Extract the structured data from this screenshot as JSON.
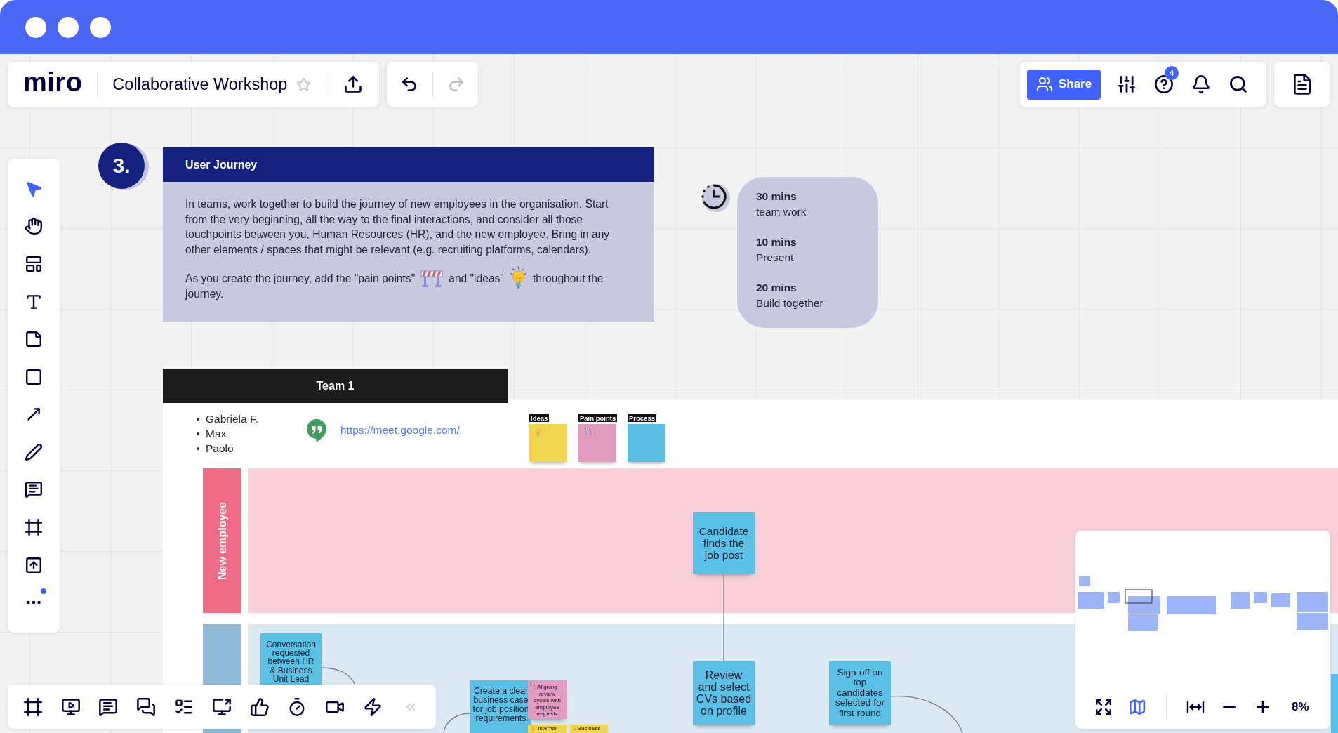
{
  "board_header": {
    "logo": "miro",
    "title": "Collaborative Workshop",
    "starred": false
  },
  "history": [
    {
      "kind": "undo",
      "disabled": false
    },
    {
      "kind": "redo",
      "disabled": true
    }
  ],
  "top_actions": {
    "share_label": "Share",
    "help_badge": "4"
  },
  "tools": [
    {
      "kind": "select",
      "selected": true,
      "notification": false
    },
    {
      "kind": "hand",
      "selected": false,
      "notification": false
    },
    {
      "kind": "templates",
      "selected": false,
      "notification": false
    },
    {
      "kind": "text",
      "selected": false,
      "notification": false
    },
    {
      "kind": "sticky",
      "selected": false,
      "notification": false
    },
    {
      "kind": "shape",
      "selected": false,
      "notification": false
    },
    {
      "kind": "arrow",
      "selected": false,
      "notification": false
    },
    {
      "kind": "pen",
      "selected": false,
      "notification": false
    },
    {
      "kind": "comment",
      "selected": false,
      "notification": false
    },
    {
      "kind": "frame",
      "selected": false,
      "notification": false
    },
    {
      "kind": "upload",
      "selected": false,
      "notification": false
    },
    {
      "kind": "more",
      "selected": false,
      "notification": true
    }
  ],
  "collaboration_tools": [
    {
      "kind": "frames"
    },
    {
      "kind": "present"
    },
    {
      "kind": "comments"
    },
    {
      "kind": "chat"
    },
    {
      "kind": "cards"
    },
    {
      "kind": "screen_share"
    },
    {
      "kind": "voting"
    },
    {
      "kind": "timer"
    },
    {
      "kind": "video"
    },
    {
      "kind": "lightning"
    },
    {
      "kind": "collapse"
    }
  ],
  "board": {
    "step": "3.",
    "instructions": {
      "title": "User Journey",
      "paragraph": "In teams, work together to build the journey of new employees in the organisation. Start from the very beginning, all the way to the final interactions, and consider all those touchpoints between you, Human Resources (HR), and the new employee. Bring in any other elements / spaces that might be relevant (e.g. recruiting platforms, calendars).",
      "closing": [
        {
          "kind": "text",
          "text": "As you create the journey, add the \"pain points\""
        },
        {
          "kind": "barrier"
        },
        {
          "kind": "text",
          "text": "and \"ideas\""
        },
        {
          "kind": "bulb"
        },
        {
          "kind": "text",
          "text": "throughout the"
        },
        {
          "kind": "text",
          "text": "journey."
        }
      ]
    },
    "timing": [
      {
        "duration": "30 mins",
        "activity": "team work"
      },
      {
        "duration": "10 mins",
        "activity": "Present"
      },
      {
        "duration": "20 mins",
        "activity": "Build together"
      }
    ],
    "team": {
      "title": "Team 1",
      "members": [
        "Gabriela F.",
        "Max",
        "Paolo"
      ],
      "meeting_link": "https://meet.google.com/",
      "legend": [
        {
          "kind": "idea",
          "label": "Ideas",
          "color": "#f2d54f"
        },
        {
          "kind": "pain",
          "label": "Pain points",
          "color": "#e19bbf"
        },
        {
          "kind": "process",
          "label": "Process",
          "color": "#5bbfe4"
        }
      ]
    },
    "lanes": [
      {
        "label": "New employee",
        "color": "#ee6c86"
      },
      {
        "color": "#8fbbd9"
      }
    ],
    "stickies": [
      {
        "kind": "process",
        "text": "Candidate finds the job post",
        "color": "#5bc0e6"
      },
      {
        "kind": "process",
        "text": "Conversation requested between HR & Business Unit Lead",
        "color": "#5bc0e6"
      },
      {
        "kind": "process",
        "text": "Create a clear business case for job position requirements",
        "color": "#5bc0e6"
      },
      {
        "kind": "pain",
        "text": "Aligning review cycles with employee requests",
        "color": "#e39bc0"
      },
      {
        "kind": "idea",
        "text": "Internal",
        "color": "#f2d54f"
      },
      {
        "kind": "idea",
        "text": "Business",
        "color": "#f2d54f"
      },
      {
        "kind": "process",
        "text": "Review and select CVs based on profile",
        "color": "#5bc0e6"
      },
      {
        "kind": "process",
        "text": "Sign-off on top candidates selected for first round",
        "color": "#5bc0e6"
      },
      {
        "kind": "process",
        "color": "#5bc0e6"
      }
    ]
  },
  "minimap": {
    "view_toggles": [
      {
        "kind": "expand",
        "selected": false
      },
      {
        "kind": "map",
        "selected": true
      }
    ],
    "zoom_controls": [
      {
        "kind": "fit"
      },
      {
        "kind": "zoom_out"
      },
      {
        "kind": "zoom_in"
      }
    ],
    "zoom_level": "8%"
  }
}
